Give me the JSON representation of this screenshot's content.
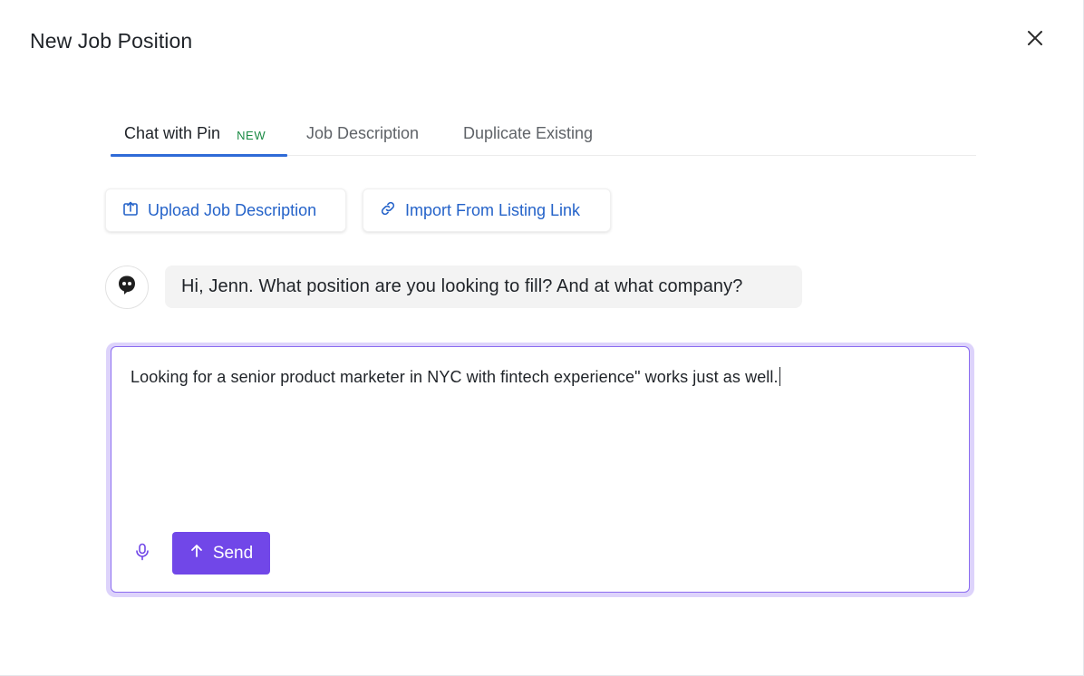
{
  "modal": {
    "title": "New Job Position",
    "close_icon": "close-icon"
  },
  "tabs": [
    {
      "label": "Chat with Pin",
      "badge": "NEW",
      "active": true
    },
    {
      "label": "Job Description",
      "active": false
    },
    {
      "label": "Duplicate Existing",
      "active": false
    }
  ],
  "actions": {
    "upload": {
      "label": "Upload Job Description",
      "icon": "upload-icon"
    },
    "import": {
      "label": "Import From Listing Link",
      "icon": "link-icon"
    }
  },
  "chat": {
    "assistant_avatar_icon": "pin-bot-icon",
    "assistant_message": "Hi, Jenn. What position are you looking to fill? And at what company?"
  },
  "composer": {
    "value": "Looking for a senior product marketer in NYC with fintech experience\" works just as well.",
    "mic_icon": "microphone-icon",
    "send_label": "Send",
    "send_icon": "arrow-up-icon"
  },
  "colors": {
    "accent_purple": "#7147e8",
    "link_blue": "#2563c9",
    "tab_underline": "#2f6bd7",
    "badge_green": "#1a8a44"
  }
}
